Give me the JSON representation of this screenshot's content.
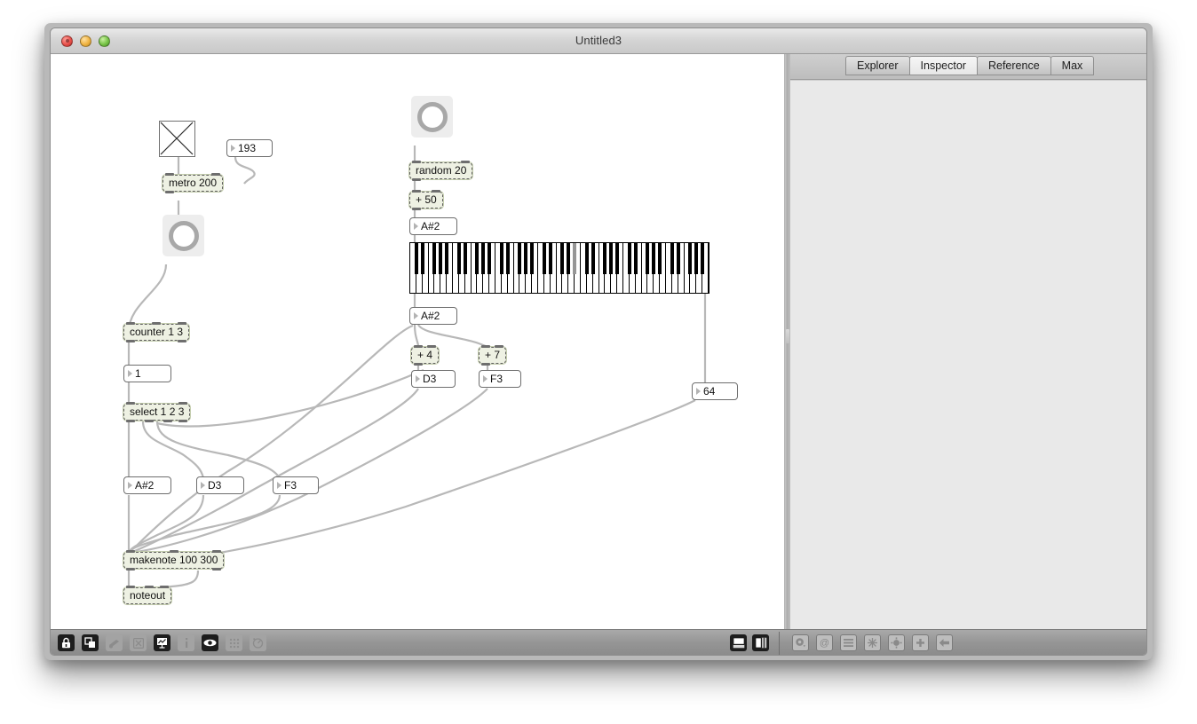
{
  "window": {
    "title": "Untitled3",
    "traffic_lights": [
      "close-button",
      "minimize-button",
      "zoom-button"
    ]
  },
  "sidebar": {
    "tabs": [
      {
        "label": "Explorer",
        "active": false
      },
      {
        "label": "Inspector",
        "active": true
      },
      {
        "label": "Reference",
        "active": false
      },
      {
        "label": "Max",
        "active": false
      }
    ]
  },
  "toolbar": {
    "left_items": [
      {
        "name": "lock-icon",
        "enabled": true
      },
      {
        "name": "objects-palette-icon",
        "enabled": true
      },
      {
        "name": "telescope-icon",
        "enabled": false
      },
      {
        "name": "x-box-icon",
        "enabled": false
      },
      {
        "name": "presentation-icon",
        "enabled": true
      },
      {
        "name": "info-icon",
        "enabled": false
      },
      {
        "name": "eye-icon",
        "enabled": true
      },
      {
        "name": "grid-icon",
        "enabled": false
      },
      {
        "name": "gauge-icon",
        "enabled": false
      }
    ],
    "layout_items": [
      {
        "name": "layout-bottom-panel-icon",
        "enabled": true
      },
      {
        "name": "layout-side-panel-icon",
        "enabled": true
      }
    ],
    "right_items": [
      {
        "name": "gear-icon",
        "enabled": false
      },
      {
        "name": "at-sign-icon",
        "enabled": false
      },
      {
        "name": "list-icon",
        "enabled": false
      },
      {
        "name": "snowflake-icon",
        "enabled": false
      },
      {
        "name": "sun-icon",
        "enabled": false
      },
      {
        "name": "plus-icon",
        "enabled": false
      },
      {
        "name": "back-arrow-icon",
        "enabled": false
      }
    ]
  },
  "patcher": {
    "colors": {
      "cord": "#b8b8b8",
      "object_fill": "#eef1e3",
      "object_border": "#5f5f5f",
      "message_fill": "#ffffff",
      "message_border": "#6e6e6e",
      "key_selected": "#969696"
    },
    "objects": [
      {
        "id": "toggle",
        "name": "toggle",
        "type": "toggle",
        "text": ""
      },
      {
        "id": "num193",
        "name": "number-box-193",
        "type": "number",
        "text": "193"
      },
      {
        "id": "metro",
        "name": "metro-object",
        "type": "object",
        "text": "metro 200"
      },
      {
        "id": "bang1",
        "name": "bang-button-left",
        "type": "bang",
        "text": ""
      },
      {
        "id": "counter",
        "name": "counter-object",
        "type": "object",
        "text": "counter 1 3"
      },
      {
        "id": "num1",
        "name": "number-box-1",
        "type": "number",
        "text": "1"
      },
      {
        "id": "select",
        "name": "select-object",
        "type": "object",
        "text": "select 1 2 3"
      },
      {
        "id": "msgAs2_left",
        "name": "message-box-asharp2-left",
        "type": "message",
        "text": "A#2"
      },
      {
        "id": "msgD3_left",
        "name": "message-box-d3-left",
        "type": "message",
        "text": "D3"
      },
      {
        "id": "msgF3_left",
        "name": "message-box-f3-left",
        "type": "message",
        "text": "F3"
      },
      {
        "id": "makenote",
        "name": "makenote-object",
        "type": "object",
        "text": "makenote 100 300"
      },
      {
        "id": "noteout",
        "name": "noteout-object",
        "type": "object",
        "text": "noteout"
      },
      {
        "id": "bang2",
        "name": "bang-button-right",
        "type": "bang",
        "text": ""
      },
      {
        "id": "random",
        "name": "random-object",
        "type": "object",
        "text": "random 20"
      },
      {
        "id": "plus50",
        "name": "plus-50-object",
        "type": "object",
        "text": "+ 50"
      },
      {
        "id": "msgAs2_top",
        "name": "message-box-asharp2-top",
        "type": "message",
        "text": "A#2"
      },
      {
        "id": "kslider",
        "name": "kslider-keyboard",
        "type": "kslider",
        "text": ""
      },
      {
        "id": "msgAs2_mid",
        "name": "message-box-asharp2-mid",
        "type": "message",
        "text": "A#2"
      },
      {
        "id": "plus4",
        "name": "plus-4-object",
        "type": "object",
        "text": "+ 4"
      },
      {
        "id": "plus7",
        "name": "plus-7-object",
        "type": "object",
        "text": "+ 7"
      },
      {
        "id": "msgD3_mid",
        "name": "message-box-d3-mid",
        "type": "message",
        "text": "D3"
      },
      {
        "id": "msgF3_mid",
        "name": "message-box-f3-mid",
        "type": "message",
        "text": "F3"
      },
      {
        "id": "num64",
        "name": "number-box-64",
        "type": "number",
        "text": "64"
      }
    ],
    "kslider": {
      "octaves": 7,
      "selected_key": "A#",
      "selected_octave_index": 3
    }
  }
}
